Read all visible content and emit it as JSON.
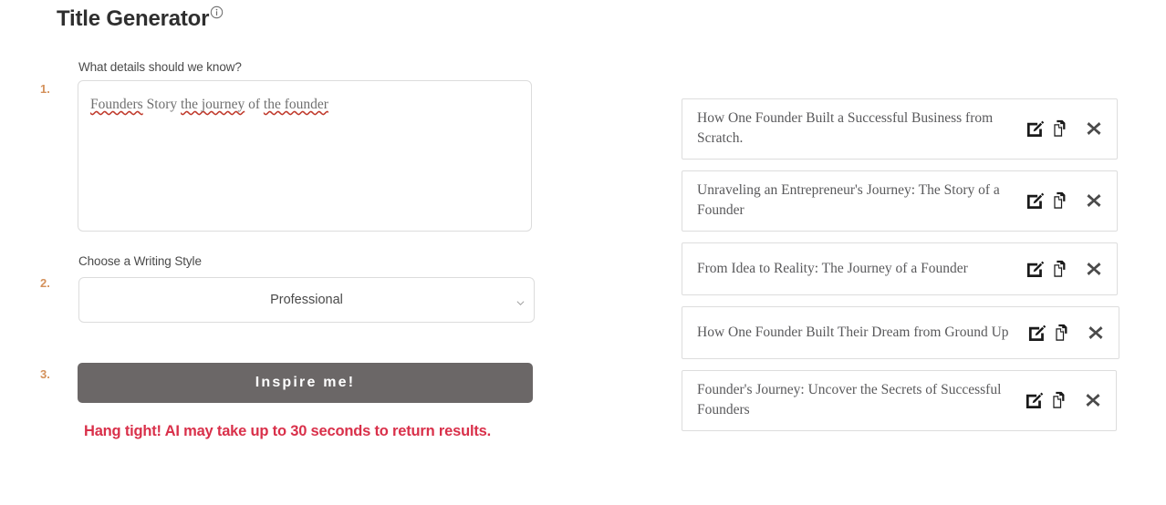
{
  "header": {
    "title": "Title Generator",
    "info_icon": "info-circle-icon"
  },
  "form": {
    "steps": [
      "1.",
      "2.",
      "3."
    ],
    "details": {
      "label": "What details should we know?",
      "value": "Founders Story the journey of the founder",
      "placeholder": "",
      "spellcheck_words": [
        "Founders",
        "the journey",
        "the founder"
      ]
    },
    "style": {
      "label": "Choose a Writing Style",
      "selected": "Professional",
      "options": [
        "Professional"
      ],
      "chevron_icon": "chevron-down-icon"
    },
    "submit": {
      "label": "Inspire me!",
      "color": "#6b6767"
    },
    "notice": {
      "text": "Hang tight! AI may take up to 30 seconds to return results.",
      "color": "#d9304a"
    }
  },
  "results": {
    "card_icons": {
      "edit": "edit-pencil-icon",
      "copy": "copy-icon",
      "close": "close-x-icon"
    },
    "items": [
      {
        "title": "How One Founder Built a Successful Business from Scratch."
      },
      {
        "title": "Unraveling an Entrepreneur's Journey: The Story of a Founder"
      },
      {
        "title": "From Idea to Reality: The Journey of a Founder"
      },
      {
        "title": "How One Founder Built Their Dream from Ground Up"
      },
      {
        "title": "Founder's Journey: Uncover the Secrets of Successful Founders"
      }
    ]
  },
  "colors": {
    "step_number": "#d4915b",
    "button": "#6b6767",
    "notice": "#d9304a",
    "card_border": "#dddddd",
    "spellcheck": "#c0392b"
  }
}
